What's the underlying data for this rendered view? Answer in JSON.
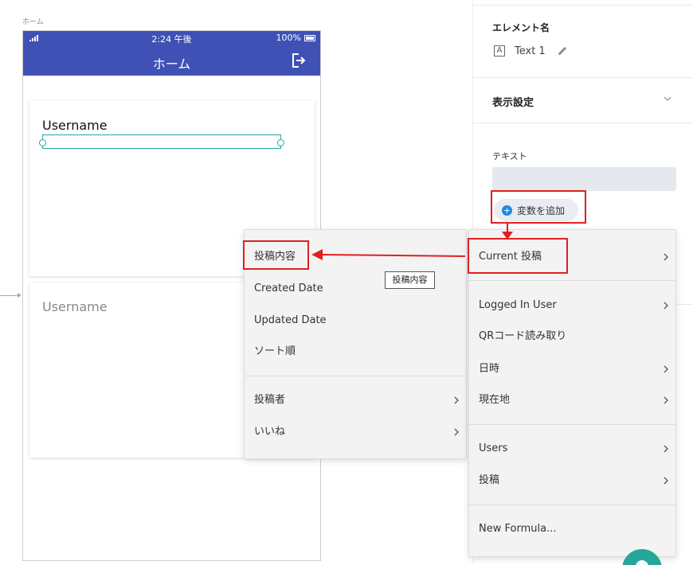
{
  "canvas": {
    "screen_label": "ホーム"
  },
  "phone": {
    "status_time": "2:24 午後",
    "battery": "100%",
    "title": "ホーム",
    "cards": [
      {
        "username": "Username"
      },
      {
        "username": "Username"
      }
    ]
  },
  "panel": {
    "element_name_label": "エレメント名",
    "text_icon_letter": "A",
    "element_name": "Text 1",
    "display_settings": "表示設定",
    "text_label": "テキスト",
    "add_variable": "変数を追加"
  },
  "menu_right": {
    "items": [
      {
        "label": "Current 投稿",
        "submenu": true
      },
      {
        "label": "Logged In User",
        "submenu": true
      },
      {
        "label": "QRコード読み取り",
        "submenu": false
      },
      {
        "label": "日時",
        "submenu": true
      },
      {
        "label": "現在地",
        "submenu": true
      },
      {
        "label": "Users",
        "submenu": true
      },
      {
        "label": "投稿",
        "submenu": true
      },
      {
        "label": "New Formula...",
        "submenu": false
      }
    ]
  },
  "menu_left": {
    "items": [
      {
        "label": "投稿内容",
        "submenu": false
      },
      {
        "label": "Created Date",
        "submenu": false
      },
      {
        "label": "Updated Date",
        "submenu": false
      },
      {
        "label": "ソート順",
        "submenu": false
      },
      {
        "label": "投稿者",
        "submenu": true
      },
      {
        "label": "いいね",
        "submenu": true
      }
    ]
  },
  "tooltip": "投稿内容",
  "colors": {
    "appbar": "#3f51b5",
    "accent": "#26a69a",
    "annotation": "#e02020",
    "plus": "#1e88e5"
  }
}
